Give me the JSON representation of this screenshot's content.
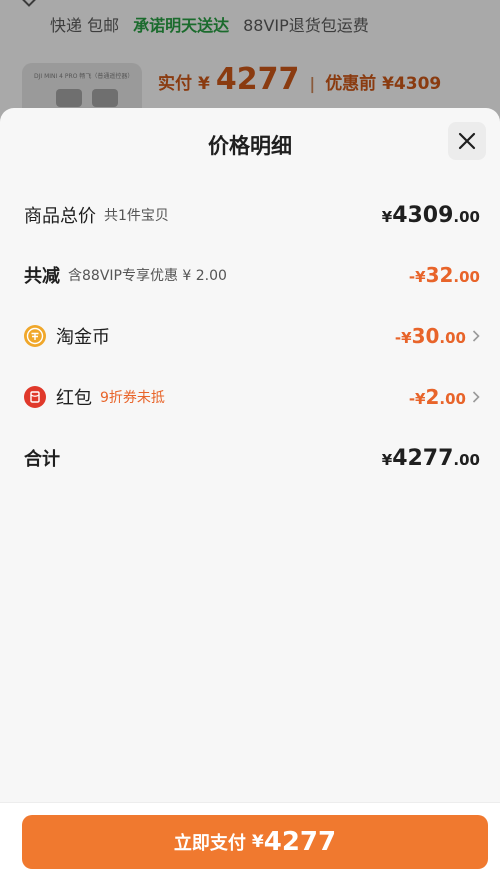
{
  "background": {
    "shipping": {
      "delivery": "快递 包邮",
      "promise": "承诺明天送达",
      "return": "88VIP退货包运费"
    },
    "product": {
      "image_text": "DJI MINI 4 PRO 畅飞（普通遥控器）"
    },
    "price": {
      "paid_label": "实付",
      "currency": "¥",
      "paid_value": "4277",
      "original_label": "优惠前 ¥4309"
    }
  },
  "sheet": {
    "title": "价格明细",
    "close_icon": "close-icon",
    "rows": {
      "total": {
        "label": "商品总价",
        "sub": "共1件宝贝",
        "cur": "¥",
        "int": "4309",
        "dec": ".00"
      },
      "discount": {
        "label": "共减",
        "sub": "含88VIP专享优惠 ¥ 2.00",
        "cur": "-¥",
        "int": "32",
        "dec": ".00"
      },
      "coins": {
        "label": "淘金币",
        "cur": "-¥",
        "int": "30",
        "dec": ".00"
      },
      "redpacket": {
        "label": "红包",
        "sub": "9折券未抵",
        "cur": "-¥",
        "int": "2",
        "dec": ".00"
      },
      "sum": {
        "label": "合计",
        "cur": "¥",
        "int": "4277",
        "dec": ".00"
      }
    }
  },
  "pay_button": {
    "label": "立即支付",
    "currency": "¥",
    "amount": "4277"
  },
  "colors": {
    "accent": "#f0792f",
    "discount": "#e8642a",
    "coin": "#f0a72a",
    "redpacket": "#e0392b"
  }
}
